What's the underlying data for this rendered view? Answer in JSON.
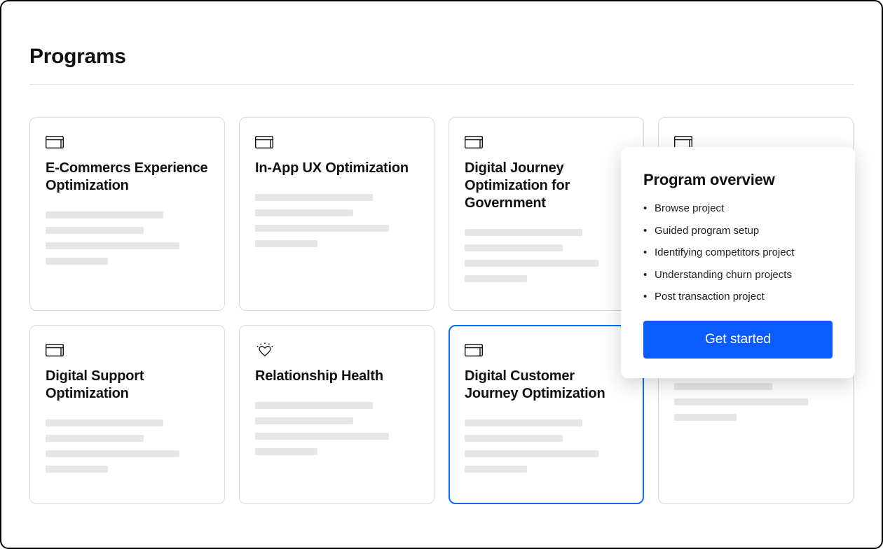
{
  "page": {
    "title": "Programs"
  },
  "cards": [
    {
      "icon": "window",
      "title": "E-Commercs Experience Optimization",
      "selected": false
    },
    {
      "icon": "window",
      "title": "In-App UX Optimization",
      "selected": false
    },
    {
      "icon": "window",
      "title": "Digital Journey Optimization for Government",
      "selected": false
    },
    {
      "icon": "window",
      "title": "",
      "selected": false
    },
    {
      "icon": "window",
      "title": "Digital Support Optimization",
      "selected": false
    },
    {
      "icon": "heart",
      "title": "Relationship Health",
      "selected": false
    },
    {
      "icon": "window",
      "title": "Digital Customer Journey Optimization",
      "selected": true
    },
    {
      "icon": "window",
      "title": "",
      "selected": false
    }
  ],
  "popover": {
    "title": "Program overview",
    "items": [
      "Browse project",
      "Guided program setup",
      "Identifying competitors project",
      "Understanding churn projects",
      "Post transaction project"
    ],
    "cta": "Get started"
  },
  "colors": {
    "primary": "#0b5cff",
    "selected_border": "#0b6cff"
  }
}
